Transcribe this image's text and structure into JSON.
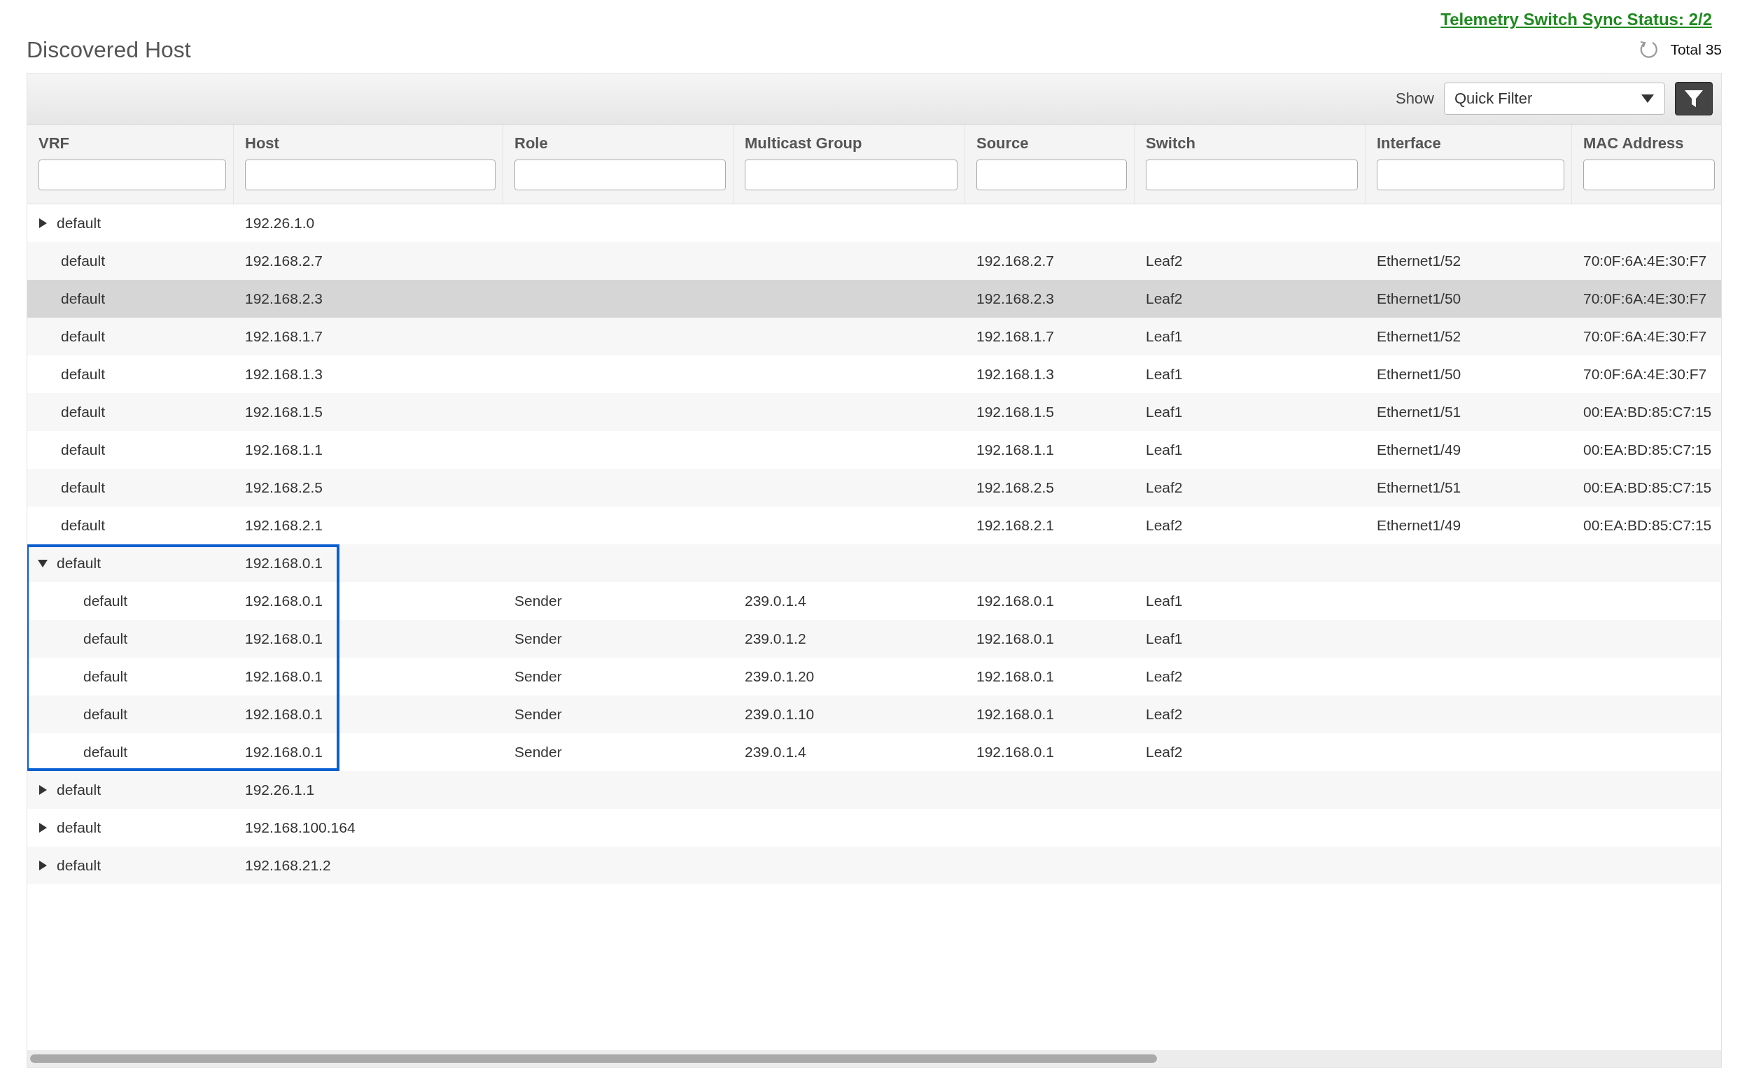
{
  "sync_status": "Telemetry Switch Sync Status: 2/2",
  "title": "Discovered Host",
  "total": "Total 35",
  "toolbar": {
    "show_label": "Show",
    "filter_select": "Quick Filter"
  },
  "table": {
    "columns": [
      "VRF",
      "Host",
      "Role",
      "Multicast Group",
      "Source",
      "Switch",
      "Interface",
      "MAC Address"
    ],
    "rows": [
      {
        "kind": "group",
        "expanded": false,
        "selected": false,
        "cells": [
          "default",
          "192.26.1.0",
          "",
          "",
          "",
          "",
          "",
          ""
        ]
      },
      {
        "kind": "host",
        "selected": false,
        "cells": [
          "default",
          "192.168.2.7",
          "",
          "",
          "192.168.2.7",
          "Leaf2",
          "Ethernet1/52",
          "70:0F:6A:4E:30:F7"
        ]
      },
      {
        "kind": "host",
        "selected": true,
        "cells": [
          "default",
          "192.168.2.3",
          "",
          "",
          "192.168.2.3",
          "Leaf2",
          "Ethernet1/50",
          "70:0F:6A:4E:30:F7"
        ]
      },
      {
        "kind": "host",
        "selected": false,
        "cells": [
          "default",
          "192.168.1.7",
          "",
          "",
          "192.168.1.7",
          "Leaf1",
          "Ethernet1/52",
          "70:0F:6A:4E:30:F7"
        ]
      },
      {
        "kind": "host",
        "selected": false,
        "cells": [
          "default",
          "192.168.1.3",
          "",
          "",
          "192.168.1.3",
          "Leaf1",
          "Ethernet1/50",
          "70:0F:6A:4E:30:F7"
        ]
      },
      {
        "kind": "host",
        "selected": false,
        "cells": [
          "default",
          "192.168.1.5",
          "",
          "",
          "192.168.1.5",
          "Leaf1",
          "Ethernet1/51",
          "00:EA:BD:85:C7:15"
        ]
      },
      {
        "kind": "host",
        "selected": false,
        "cells": [
          "default",
          "192.168.1.1",
          "",
          "",
          "192.168.1.1",
          "Leaf1",
          "Ethernet1/49",
          "00:EA:BD:85:C7:15"
        ]
      },
      {
        "kind": "host",
        "selected": false,
        "cells": [
          "default",
          "192.168.2.5",
          "",
          "",
          "192.168.2.5",
          "Leaf2",
          "Ethernet1/51",
          "00:EA:BD:85:C7:15"
        ]
      },
      {
        "kind": "host",
        "selected": false,
        "cells": [
          "default",
          "192.168.2.1",
          "",
          "",
          "192.168.2.1",
          "Leaf2",
          "Ethernet1/49",
          "00:EA:BD:85:C7:15"
        ]
      },
      {
        "kind": "group",
        "expanded": true,
        "outlined": true,
        "selected": false,
        "cells": [
          "default",
          "192.168.0.1",
          "",
          "",
          "",
          "",
          "",
          ""
        ],
        "children": [
          {
            "kind": "host",
            "selected": false,
            "cells": [
              "default",
              "192.168.0.1",
              "Sender",
              "239.0.1.4",
              "192.168.0.1",
              "Leaf1",
              "",
              ""
            ]
          },
          {
            "kind": "host",
            "selected": false,
            "cells": [
              "default",
              "192.168.0.1",
              "Sender",
              "239.0.1.2",
              "192.168.0.1",
              "Leaf1",
              "",
              ""
            ]
          },
          {
            "kind": "host",
            "selected": false,
            "cells": [
              "default",
              "192.168.0.1",
              "Sender",
              "239.0.1.20",
              "192.168.0.1",
              "Leaf2",
              "",
              ""
            ]
          },
          {
            "kind": "host",
            "selected": false,
            "cells": [
              "default",
              "192.168.0.1",
              "Sender",
              "239.0.1.10",
              "192.168.0.1",
              "Leaf2",
              "",
              ""
            ]
          },
          {
            "kind": "host",
            "selected": false,
            "cells": [
              "default",
              "192.168.0.1",
              "Sender",
              "239.0.1.4",
              "192.168.0.1",
              "Leaf2",
              "",
              ""
            ]
          }
        ]
      },
      {
        "kind": "group",
        "expanded": false,
        "selected": false,
        "cells": [
          "default",
          "192.26.1.1",
          "",
          "",
          "",
          "",
          "",
          ""
        ]
      },
      {
        "kind": "group",
        "expanded": false,
        "selected": false,
        "cells": [
          "default",
          "192.168.100.164",
          "",
          "",
          "",
          "",
          "",
          ""
        ]
      },
      {
        "kind": "group",
        "expanded": false,
        "selected": false,
        "cells": [
          "default",
          "192.168.21.2",
          "",
          "",
          "",
          "",
          "",
          ""
        ]
      }
    ]
  }
}
